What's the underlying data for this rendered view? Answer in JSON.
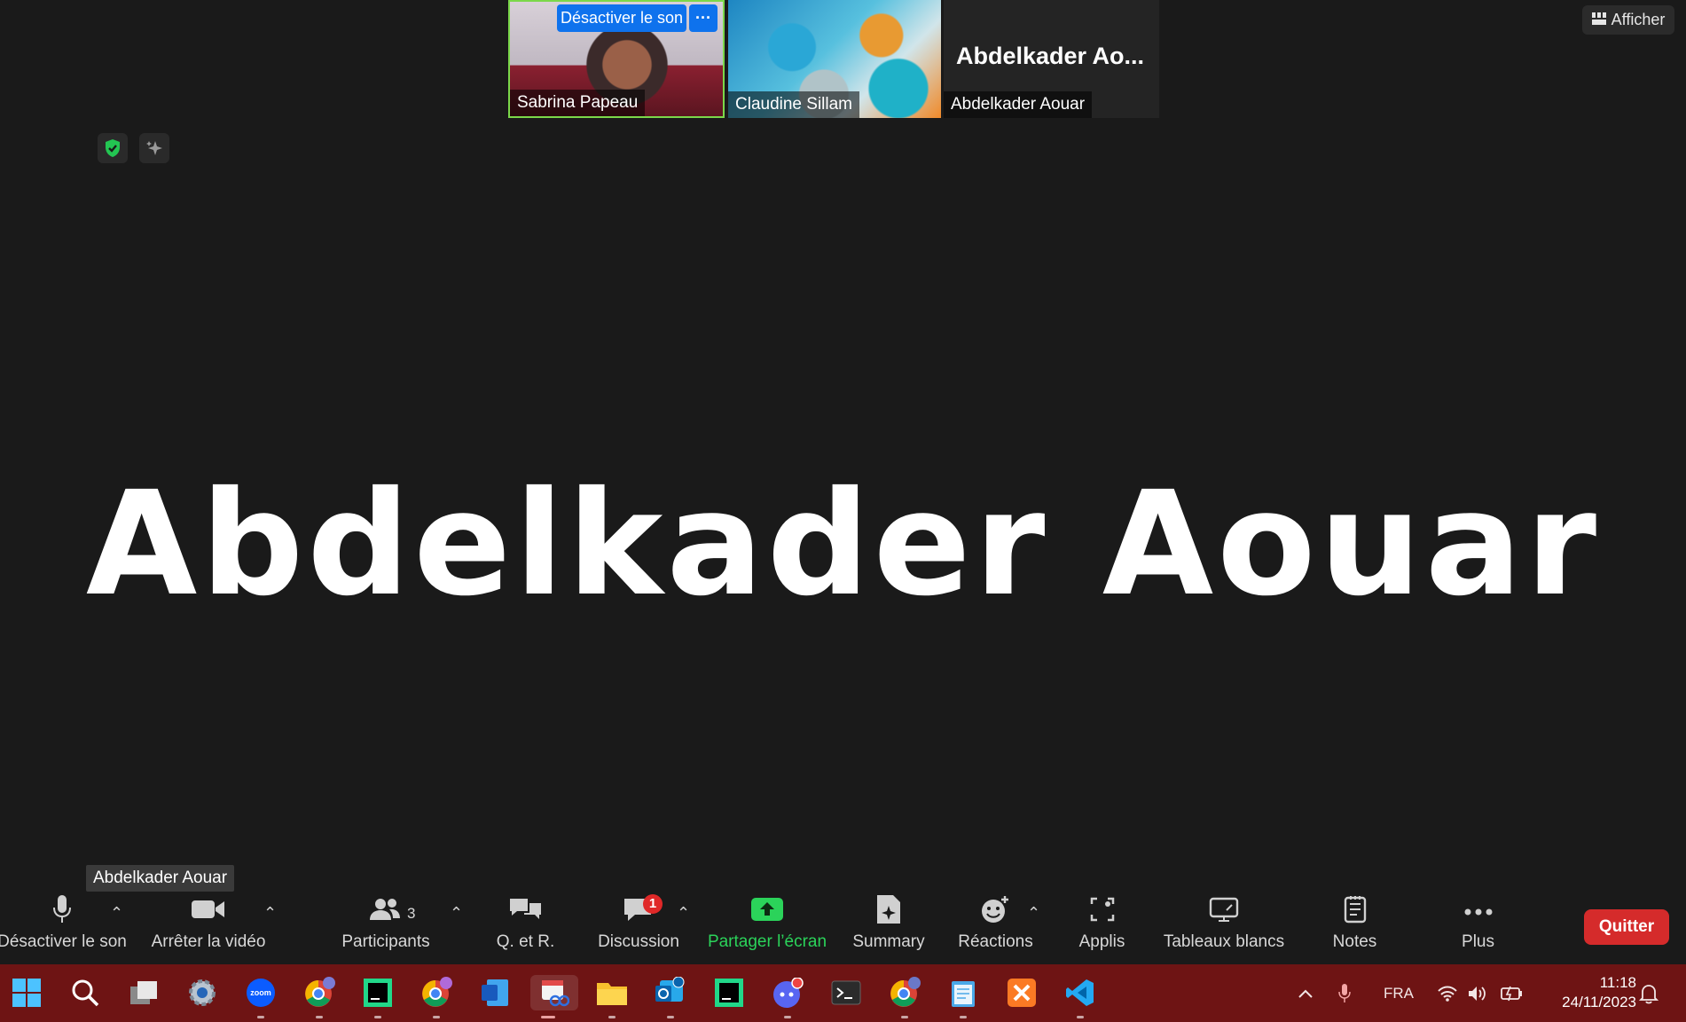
{
  "window": {
    "accent_color": "#0e72ed",
    "quit_color": "#d52b2b",
    "share_color": "#2bd35a"
  },
  "tiles": [
    {
      "name": "Sabrina Papeau",
      "mute_button": "Désactiver le son",
      "more_button": "···",
      "speaking": true
    },
    {
      "name": "Claudine Sillam"
    },
    {
      "name": "Abdelkader Aouar",
      "big_name": "Abdelkader  Ao..."
    }
  ],
  "view_button": "Afficher",
  "main_speaker": "Abdelkader Aouar",
  "speaker_tooltip": "Abdelkader Aouar",
  "toolbar": {
    "mute": "Désactiver le son",
    "video": "Arrêter la vidéo",
    "participants": "Participants",
    "participants_count": "3",
    "qa": "Q. et R.",
    "chat": "Discussion",
    "chat_badge": "1",
    "share": "Partager l’écran",
    "summary": "Summary",
    "reactions": "Réactions",
    "apps": "Applis",
    "whiteboards": "Tableaux blancs",
    "notes": "Notes",
    "more": "Plus",
    "quit": "Quitter"
  },
  "taskbar": {
    "apps": [
      "start-icon",
      "search-icon",
      "task-view-icon",
      "settings-icon",
      "zoom-icon",
      "chrome-d-icon",
      "clion-icon",
      "chrome-x-icon",
      "word-icon",
      "snipping-tool-icon",
      "file-explorer-icon",
      "outlook-new-icon",
      "pycharm-icon",
      "discord-icon",
      "terminal-icon",
      "chrome-s-icon",
      "notepad-icon",
      "xampp-icon",
      "vscode-icon"
    ],
    "zoom_label": "zoom",
    "language": "FRA",
    "time": "11:18",
    "date": "24/11/2023"
  }
}
